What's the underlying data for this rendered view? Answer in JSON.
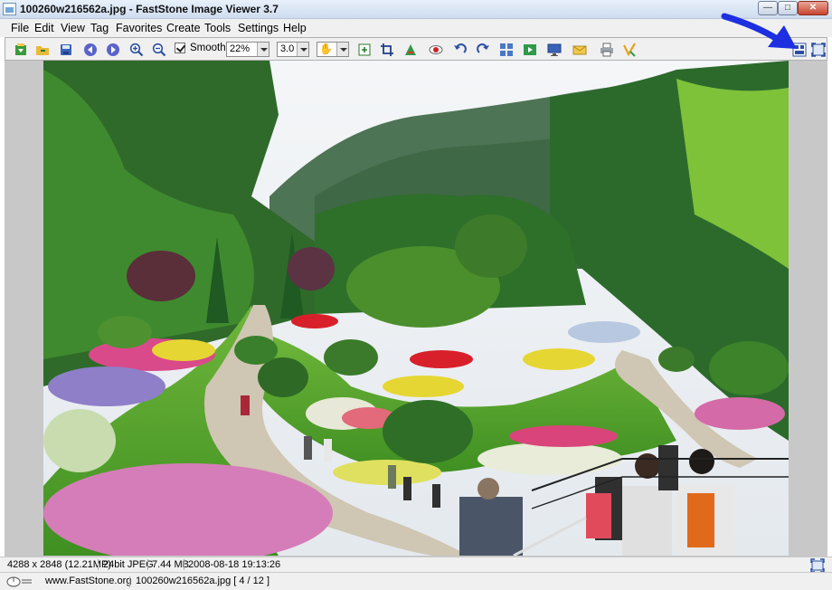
{
  "window": {
    "title": "100260w216562a.jpg  -  FastStone Image Viewer 3.7",
    "minimize": "—",
    "maximize": "□",
    "close": "✕"
  },
  "menu": [
    "File",
    "Edit",
    "View",
    "Tag",
    "Favorites",
    "Create",
    "Tools",
    "Settings",
    "Help"
  ],
  "toolbar": {
    "smooth_label": "Smooth",
    "smooth_checked": true,
    "zoom_value": "22%",
    "gamma_value": "3.0",
    "icons": [
      "open-file-icon",
      "browse-folder-icon",
      "save-icon",
      "previous-icon",
      "next-icon",
      "zoom-in-icon",
      "zoom-out-icon",
      "hand-tool-icon",
      "resize-icon",
      "crop-icon",
      "color-adjust-icon",
      "red-eye-icon",
      "rotate-left-icon",
      "rotate-right-icon",
      "thumbnails-icon",
      "slideshow-icon",
      "wallpaper-icon",
      "email-icon",
      "print-icon",
      "draw-icon",
      "browser-mode-icon",
      "fullscreen-icon"
    ]
  },
  "image": {
    "alt": "Sunken garden with winding path, colorful flower beds, evergreen trees and visitors"
  },
  "status": {
    "dimensions": "4288 x 2848 (12.21MP)",
    "format": "24bit JPEG",
    "size": "7.44 MB",
    "datetime": "2008-08-18 19:13:26"
  },
  "footer": {
    "website": "www.FastStone.org",
    "file_info": "100260w216562a.jpg [ 4 / 12 ]"
  },
  "colors": {
    "annotation_arrow": "#1d2fe0",
    "viewer_bg": "#c8c8c8",
    "toolbar_bg": "#f0f0f0"
  }
}
